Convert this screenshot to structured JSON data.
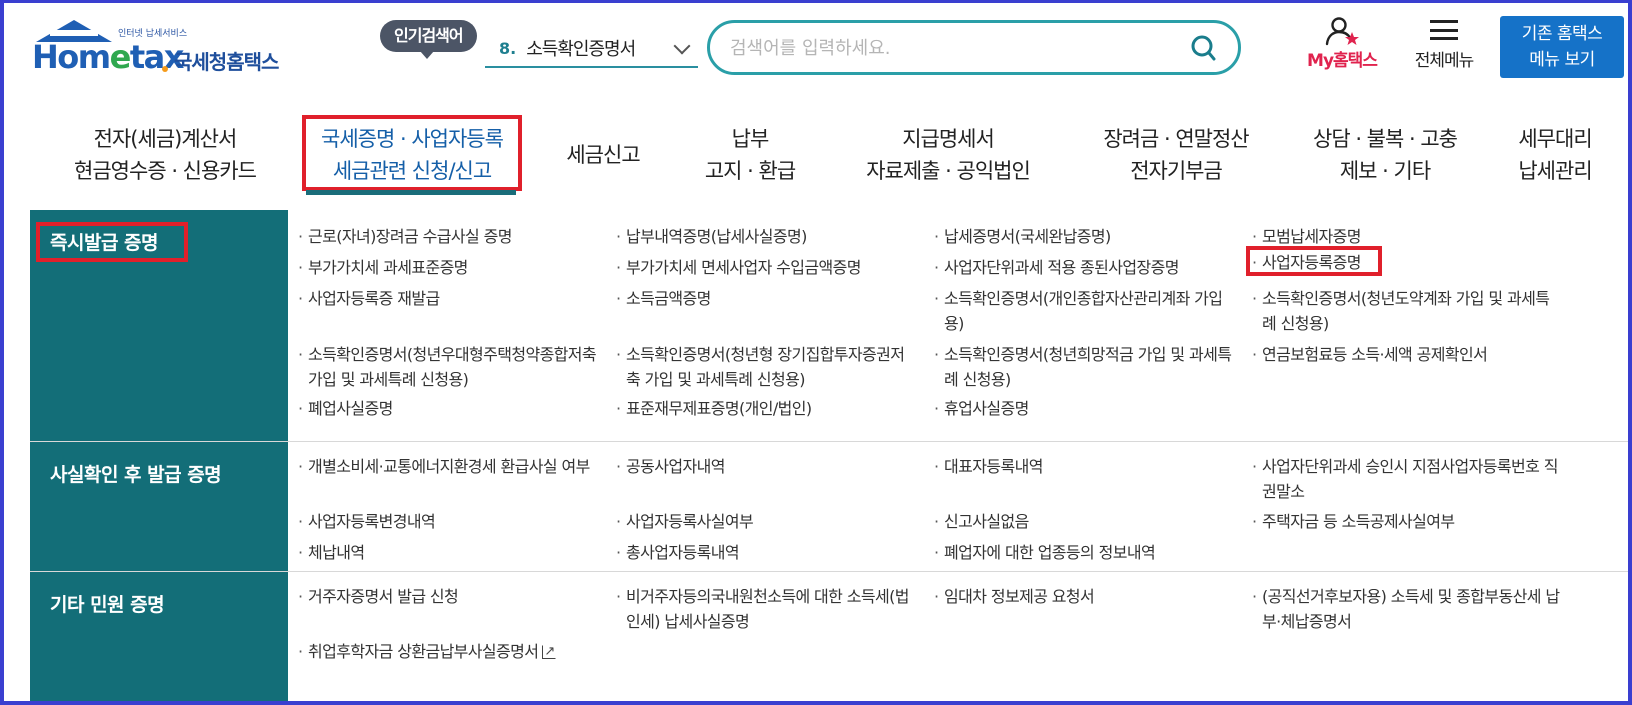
{
  "header": {
    "logo_tagline": "인터넷 납세서비스",
    "logo_main_pre": "Hom",
    "logo_main_e": "e",
    "logo_main_post": "tax",
    "logo_sub": "국세청홈택스",
    "popular_label": "인기검색어",
    "popular_rank": "8.",
    "popular_term": "소득확인증명서",
    "search_placeholder": "검색어를 입력하세요.",
    "my_hometax": "My홈택스",
    "all_menu": "전체메뉴",
    "legacy_line1": "기존 홈택스",
    "legacy_line2": "메뉴 보기"
  },
  "colors": {
    "teal": "#136e78",
    "highlight_red": "#e0202b",
    "brand_blue": "#1f5fb4",
    "legacy_btn": "#1572c8",
    "my_hometax_red": "#e0234e"
  },
  "gnb": [
    {
      "line1": "전자(세금)계산서",
      "line2": "현금영수증 · 신용카드"
    },
    {
      "line1": "국세증명 · 사업자등록",
      "line2": "세금관련 신청/신고"
    },
    {
      "line1": "세금신고",
      "line2": ""
    },
    {
      "line1": "납부",
      "line2": "고지 · 환급"
    },
    {
      "line1": "지급명세서",
      "line2": "자료제출 · 공익법인"
    },
    {
      "line1": "장려금 · 연말정산",
      "line2": "전자기부금"
    },
    {
      "line1": "상담 · 불복 · 고충",
      "line2": "제보 · 기타"
    },
    {
      "line1": "세무대리",
      "line2": "납세관리"
    }
  ],
  "sections": [
    {
      "title": "즉시발급 증명",
      "items": [
        "근로(자녀)장려금 수급사실 증명",
        "납부내역증명(납세사실증명)",
        "납세증명서(국세완납증명)",
        "모범납세자증명",
        "부가가치세 과세표준증명",
        "부가가치세 면세사업자 수입금액증명",
        "사업자단위과세 적용 종된사업장증명",
        "사업자등록증명",
        "사업자등록증 재발급",
        "소득금액증명",
        "소득확인증명서(개인종합자산관리계좌 가입용)",
        "소득확인증명서(청년도약계좌 가입 및 과세특례 신청용)",
        "소득확인증명서(청년우대형주택청약종합저축 가입 및 과세특례 신청용)",
        "소득확인증명서(청년형 장기집합투자증권저축 가입 및 과세특례 신청용)",
        "소득확인증명서(청년희망적금 가입 및 과세특례 신청용)",
        "연금보험료등 소득·세액 공제확인서",
        "폐업사실증명",
        "표준재무제표증명(개인/법인)",
        "휴업사실증명"
      ]
    },
    {
      "title": "사실확인 후 발급 증명",
      "items": [
        "개별소비세·교통에너지환경세 환급사실 여부",
        "공동사업자내역",
        "대표자등록내역",
        "사업자단위과세 승인시 지점사업자등록번호 직권말소",
        "사업자등록변경내역",
        "사업자등록사실여부",
        "신고사실없음",
        "주택자금 등 소득공제사실여부",
        "체납내역",
        "총사업자등록내역",
        "폐업자에 대한 업종등의 정보내역"
      ]
    },
    {
      "title": "기타 민원 증명",
      "items": [
        "거주자증명서 발급 신청",
        "비거주자등의국내원천소득에 대한 소득세(법인세) 납세사실증명",
        "임대차 정보제공 요청서",
        "(공직선거후보자용) 소득세 및 종합부동산세 납부·체납증명서",
        "취업후학자금 상환금납부사실증명서"
      ]
    }
  ]
}
